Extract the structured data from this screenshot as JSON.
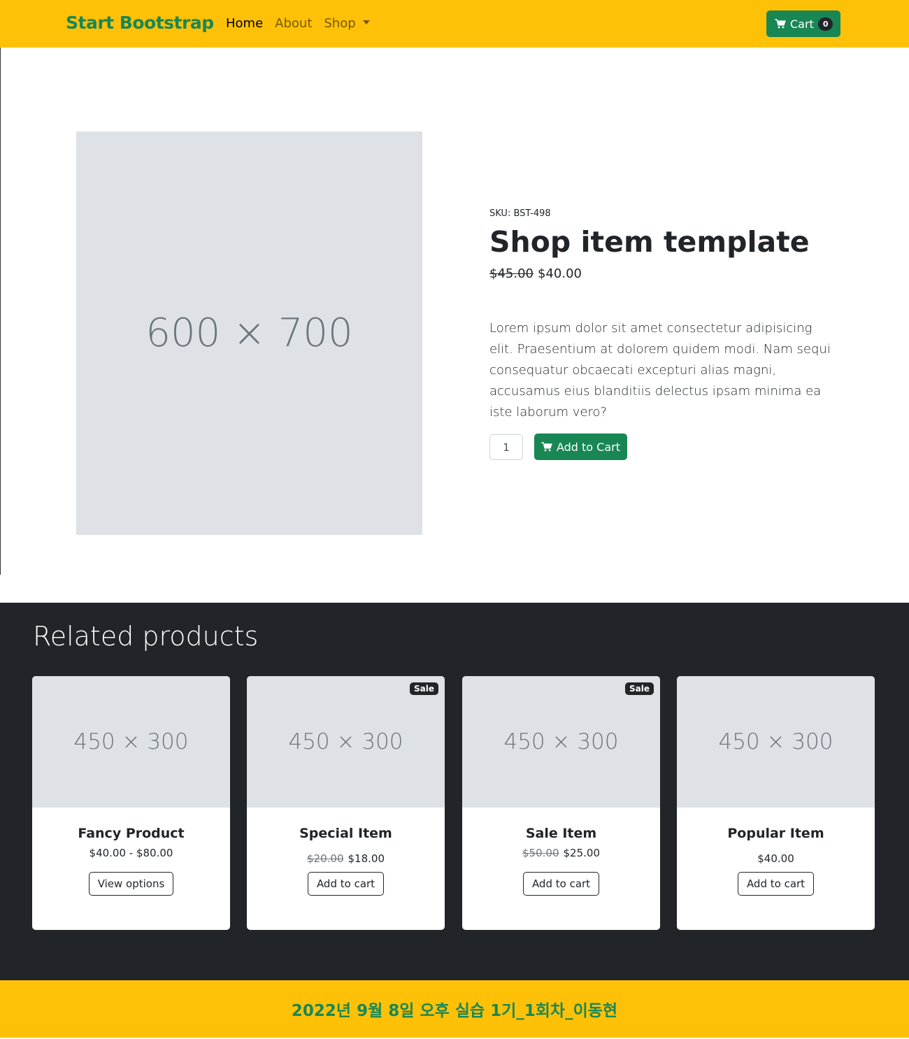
{
  "nav": {
    "brand": "Start Bootstrap",
    "links": [
      "Home",
      "About",
      "Shop"
    ],
    "cart_label": "Cart",
    "cart_count": "0"
  },
  "product": {
    "image_placeholder": "600 × 700",
    "sku": "SKU: BST-498",
    "title": "Shop item template",
    "old_price": "$45.00",
    "price": "$40.00",
    "description": "Lorem ipsum dolor sit amet consectetur adipisicing elit. Praesentium at dolorem quidem modi. Nam sequi consequatur obcaecati excepturi alias magni, accusamus eius blanditiis delectus ipsam minima ea iste laborum vero?",
    "quantity": "1",
    "add_label": "Add to Cart"
  },
  "related": {
    "heading": "Related products",
    "cards": [
      {
        "image": "450 × 300",
        "name": "Fancy Product",
        "price": "$40.00 - $80.00",
        "button": "View options"
      },
      {
        "image": "450 × 300",
        "badge": "Sale",
        "name": "Special Item",
        "old_price": "$20.00",
        "price": "$18.00",
        "button": "Add to cart"
      },
      {
        "image": "450 × 300",
        "badge": "Sale",
        "name": "Sale Item",
        "old_price": "$50.00",
        "price": "$25.00",
        "button": "Add to cart"
      },
      {
        "image": "450 × 300",
        "name": "Popular Item",
        "price": "$40.00",
        "button": "Add to cart"
      }
    ]
  },
  "footer": {
    "text": "2022년 9월 8일 오후 실습 1기_1회차_이동현"
  },
  "colors": {
    "accent": "#ffc107",
    "brand": "#198754",
    "dark": "#212529"
  }
}
